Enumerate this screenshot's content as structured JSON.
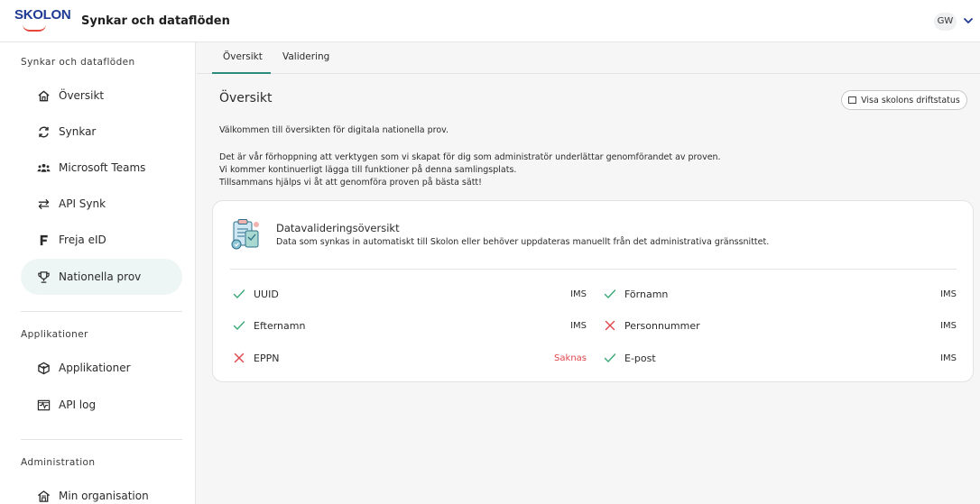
{
  "header": {
    "logo_text": "SKOLON",
    "app_title": "Synkar och dataflöden",
    "user_initials": "GW"
  },
  "sidebar": {
    "sections": [
      {
        "title": "Synkar och dataflöden",
        "items": [
          {
            "label": "Översikt",
            "icon": "home-icon"
          },
          {
            "label": "Synkar",
            "icon": "sync-icon"
          },
          {
            "label": "Microsoft Teams",
            "icon": "teams-icon"
          },
          {
            "label": "API Synk",
            "icon": "swap-arrows-icon"
          },
          {
            "label": "Freja eID",
            "icon": "freja-icon"
          },
          {
            "label": "Nationella prov",
            "icon": "trophy-icon",
            "active": true
          }
        ]
      },
      {
        "title": "Applikationer",
        "items": [
          {
            "label": "Applikationer",
            "icon": "cube-icon"
          },
          {
            "label": "API log",
            "icon": "activity-log-icon"
          }
        ]
      },
      {
        "title": "Administration",
        "items": [
          {
            "label": "Min organisation",
            "icon": "organisation-icon"
          }
        ]
      }
    ]
  },
  "tabs": [
    {
      "label": "Översikt",
      "active": true
    },
    {
      "label": "Validering",
      "active": false
    }
  ],
  "main": {
    "title": "Översikt",
    "status_button": "Visa skolons driftstatus",
    "intro_lines": [
      "Välkommen till översikten för digitala nationella prov.",
      "Det är vår förhoppning att verktygen som vi skapat för dig som administratör underlättar genomförandet av proven.",
      "Vi kommer kontinuerligt lägga till funktioner på denna samlingsplats.",
      "Tillsammans hjälps vi åt att genomföra proven på bästa sätt!"
    ]
  },
  "card": {
    "title": "Datavalideringsöversikt",
    "subtitle": "Data som synkas in automatiskt till Skolon eller behöver uppdateras manuellt från det administrativa gränssnittet.",
    "fields": [
      {
        "label": "UUID",
        "source": "IMS",
        "ok": true
      },
      {
        "label": "Förnamn",
        "source": "IMS",
        "ok": true
      },
      {
        "label": "Efternamn",
        "source": "IMS",
        "ok": true
      },
      {
        "label": "Personnummer",
        "source": "IMS",
        "ok": false
      },
      {
        "label": "EPPN",
        "source": "Saknas",
        "ok": false,
        "missing": true
      },
      {
        "label": "E-post",
        "source": "IMS",
        "ok": true
      }
    ]
  },
  "colors": {
    "accent": "#2b8c7e",
    "success": "#3aa876",
    "error": "#e0454c",
    "brand_blue": "#1f3a93",
    "brand_red": "#e8453c"
  }
}
